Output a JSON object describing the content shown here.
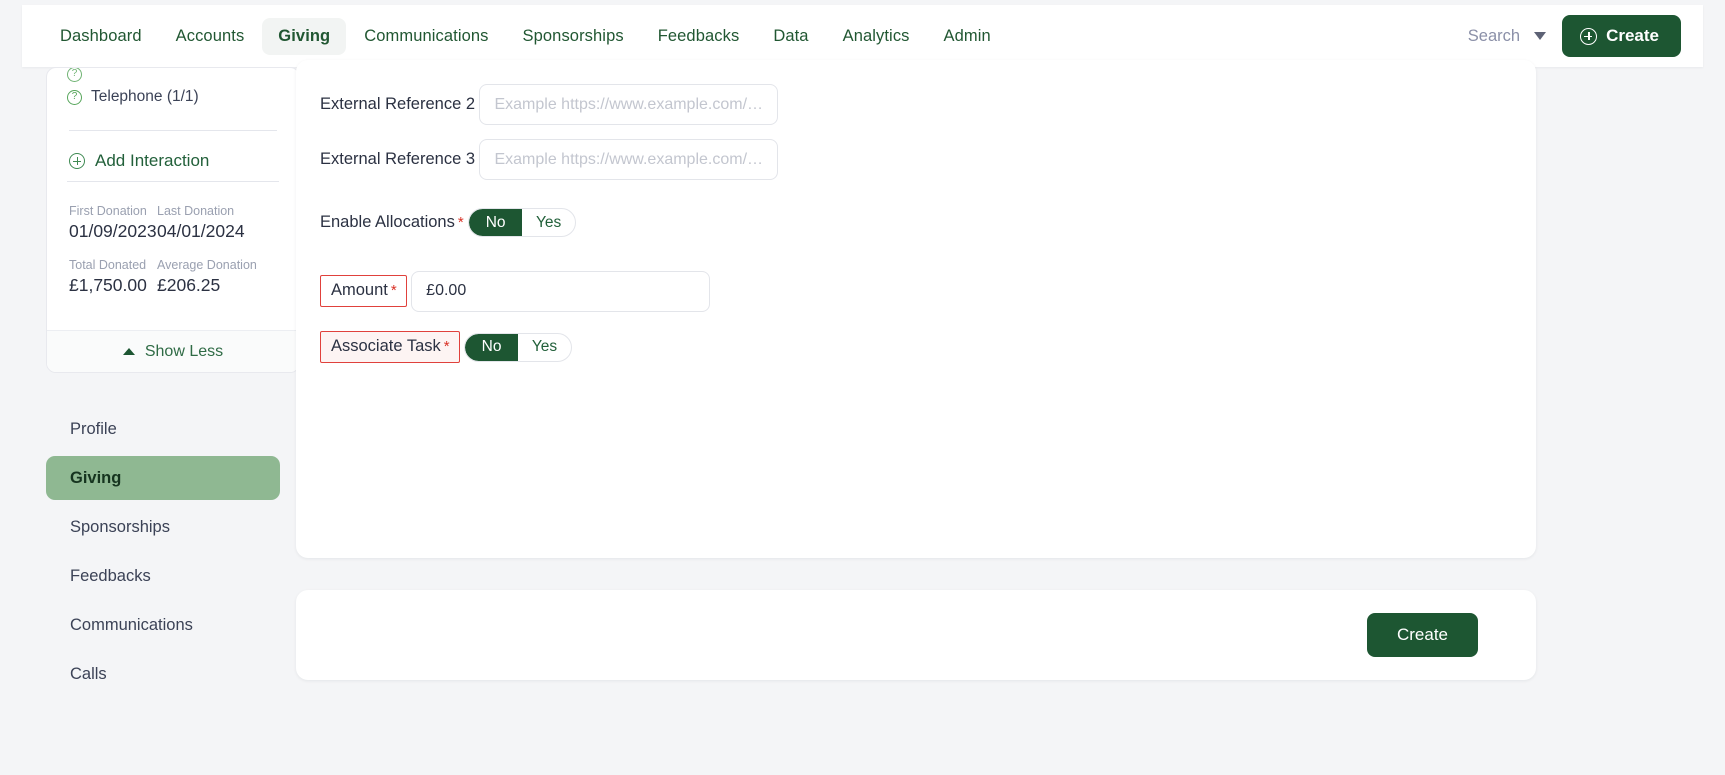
{
  "topnav": {
    "items": [
      {
        "label": "Dashboard",
        "active": false
      },
      {
        "label": "Accounts",
        "active": false
      },
      {
        "label": "Giving",
        "active": true
      },
      {
        "label": "Communications",
        "active": false
      },
      {
        "label": "Sponsorships",
        "active": false
      },
      {
        "label": "Feedbacks",
        "active": false
      },
      {
        "label": "Data",
        "active": false
      },
      {
        "label": "Analytics",
        "active": false
      },
      {
        "label": "Admin",
        "active": false
      }
    ],
    "search_label": "Search",
    "create_label": "Create",
    "caret_icon": "chevron-down-icon",
    "create_icon": "plus-circle-icon"
  },
  "summary": {
    "interaction": {
      "icon": "question-circle-icon",
      "label": "Telephone (1/1)"
    },
    "add_interaction": {
      "icon": "plus-circle-icon",
      "label": "Add Interaction"
    },
    "stats": [
      {
        "label": "First Donation",
        "value": "01/09/2023"
      },
      {
        "label": "Last Donation",
        "value": "04/01/2024"
      },
      {
        "label": "Total Donated",
        "value": "£1,750.00"
      },
      {
        "label": "Average Donation",
        "value": "£206.25"
      }
    ],
    "show_less": {
      "label": "Show Less",
      "icon": "triangle-up-icon"
    }
  },
  "section_nav": {
    "items": [
      {
        "label": "Profile",
        "active": false
      },
      {
        "label": "Giving",
        "active": true
      },
      {
        "label": "Sponsorships",
        "active": false
      },
      {
        "label": "Feedbacks",
        "active": false
      },
      {
        "label": "Communications",
        "active": false
      },
      {
        "label": "Calls",
        "active": false
      }
    ]
  },
  "form": {
    "external_reference_2": {
      "label": "External Reference 2",
      "placeholder": "Example https://www.example.com/…",
      "value": ""
    },
    "external_reference_3": {
      "label": "External Reference 3",
      "placeholder": "Example https://www.example.com/…",
      "value": ""
    },
    "enable_allocations": {
      "label": "Enable Allocations",
      "required_marker": "*",
      "options": [
        "No",
        "Yes"
      ],
      "selected": "No"
    },
    "amount": {
      "label": "Amount",
      "required_marker": "*",
      "value": "£0.00",
      "placeholder": "£0.00"
    },
    "associate_task": {
      "label": "Associate Task",
      "required_marker": "*",
      "options": [
        "No",
        "Yes"
      ],
      "selected": "No"
    }
  },
  "footer": {
    "create_label": "Create"
  },
  "colors": {
    "brand_green": "#1d5632",
    "nav_green": "#215732",
    "active_nav_bg": "#8fb892",
    "highlight_red": "#e0413c",
    "required_red": "#d93025",
    "page_bg": "#f4f5f7"
  }
}
